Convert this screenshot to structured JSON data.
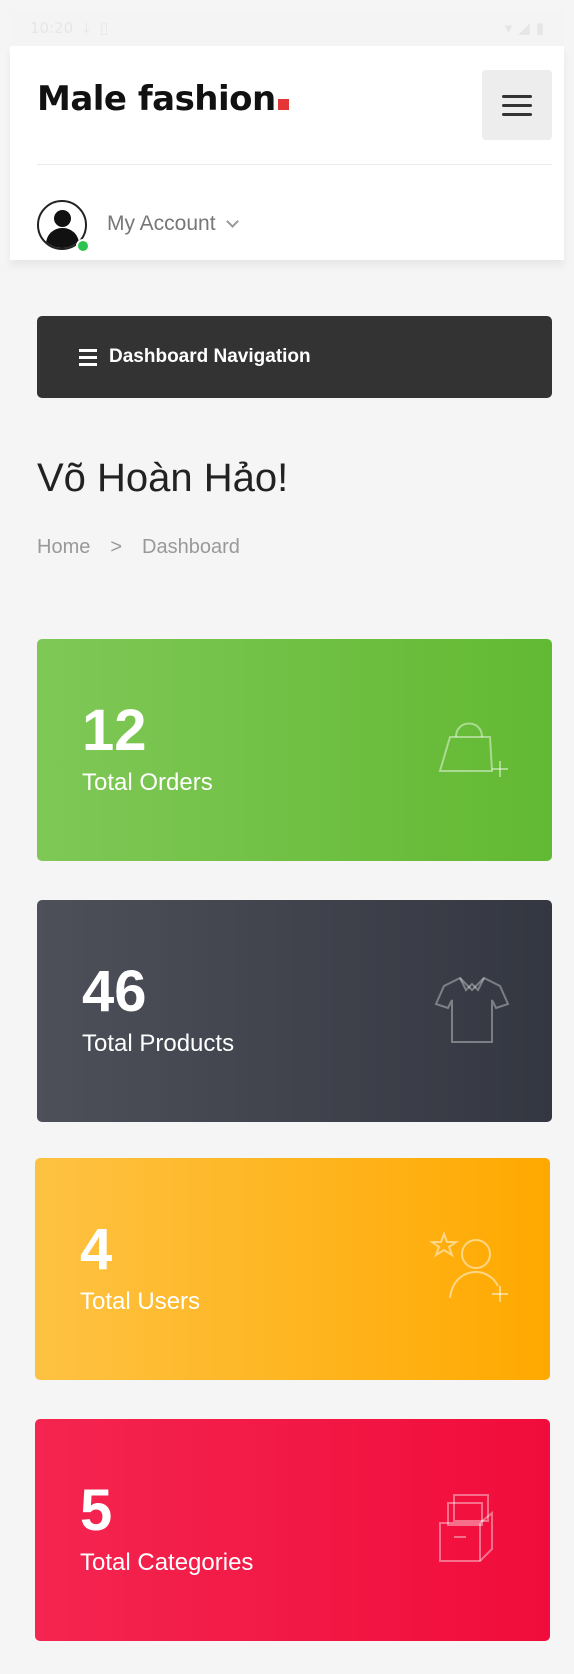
{
  "statusbar": {
    "time": "10:20"
  },
  "header": {
    "logo_text": "Male fashion",
    "account_label": "My Account"
  },
  "dashboard_nav": {
    "label": "Dashboard Navigation"
  },
  "page": {
    "title": "Võ Hoàn Hảo!",
    "breadcrumb": {
      "home": "Home",
      "separator": ">",
      "current": "Dashboard"
    }
  },
  "stats": [
    {
      "value": "12",
      "label": "Total Orders",
      "icon": "shopping-bag-plus-icon",
      "color": "#6fc146"
    },
    {
      "value": "46",
      "label": "Total Products",
      "icon": "shirt-icon",
      "color": "#3f414b"
    },
    {
      "value": "4",
      "label": "Total Users",
      "icon": "user-star-plus-icon",
      "color": "#ffb51c"
    },
    {
      "value": "5",
      "label": "Total Categories",
      "icon": "boxes-icon",
      "color": "#f31846"
    }
  ],
  "colors": {
    "accent": "#e53637",
    "online": "#2cc44f"
  }
}
